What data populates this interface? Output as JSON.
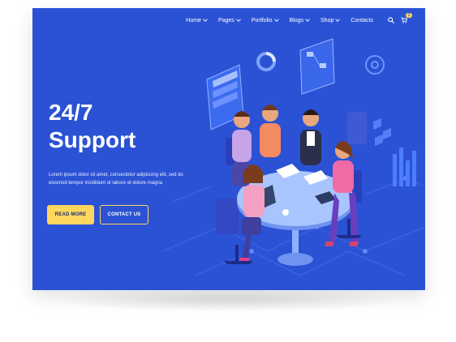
{
  "nav": {
    "items": [
      {
        "label": "Home",
        "dropdown": true
      },
      {
        "label": "Pages",
        "dropdown": true
      },
      {
        "label": "Portfolio",
        "dropdown": true
      },
      {
        "label": "Blogs",
        "dropdown": true
      },
      {
        "label": "Shop",
        "dropdown": true
      },
      {
        "label": "Contacts",
        "dropdown": false
      }
    ],
    "cart_count": "0"
  },
  "hero": {
    "title_line1": "24/7",
    "title_line2": "Support",
    "description": "Lorem ipsum dolor sit amet, consectetur adipiscing elit, sed do eiusmod tempor incididunt ut labore et dolore magna",
    "primary_button": "READ MORE",
    "secondary_button": "CONTACT US"
  },
  "colors": {
    "background": "#2b52d4",
    "accent": "#ffd75e",
    "text": "#ffffff"
  }
}
